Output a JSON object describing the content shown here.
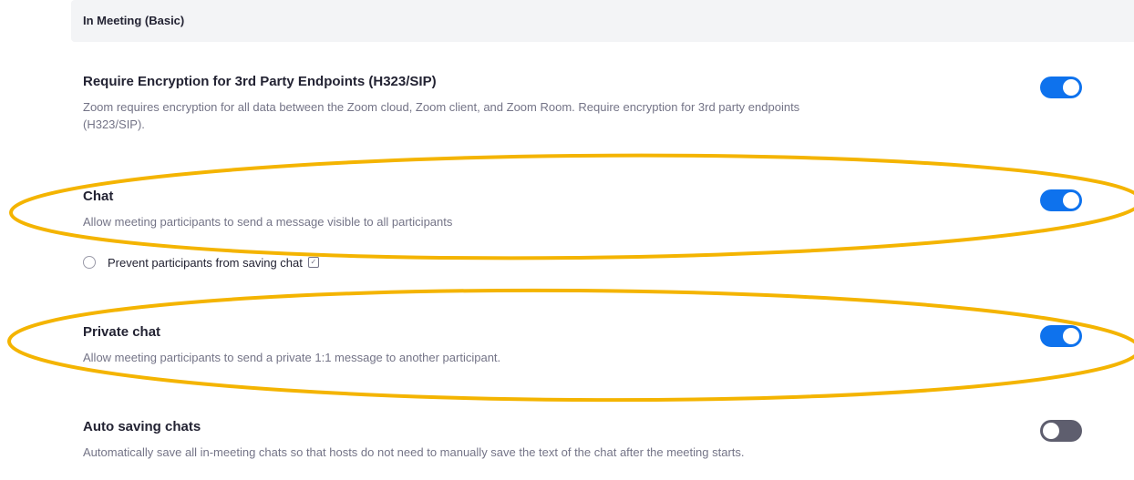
{
  "section": {
    "title": "In Meeting (Basic)"
  },
  "settings": [
    {
      "title": "Require Encryption for 3rd Party Endpoints (H323/SIP)",
      "description": "Zoom requires encryption for all data between the Zoom cloud, Zoom client, and Zoom Room. Require encryption for 3rd party endpoints (H323/SIP).",
      "enabled": true
    },
    {
      "title": "Chat",
      "description": "Allow meeting participants to send a message visible to all participants",
      "enabled": true,
      "sub_option": {
        "label": "Prevent participants from saving chat",
        "checked": false
      }
    },
    {
      "title": "Private chat",
      "description": "Allow meeting participants to send a private 1:1 message to another participant.",
      "enabled": true
    },
    {
      "title": "Auto saving chats",
      "description": "Automatically save all in-meeting chats so that hosts do not need to manually save the text of the chat after the meeting starts.",
      "enabled": false
    }
  ],
  "colors": {
    "toggle_on": "#0e72ed",
    "toggle_off": "#5e5e6e",
    "highlight": "#f4b400"
  },
  "icons": {
    "info": "info-icon"
  }
}
